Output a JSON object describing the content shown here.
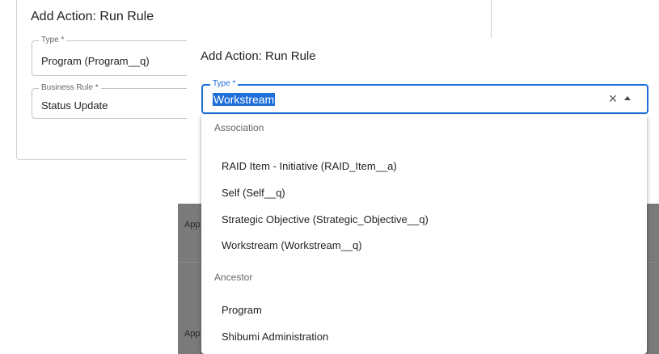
{
  "background_dialog": {
    "title": "Add Action: Run Rule",
    "type_field": {
      "label": "Type *",
      "value": "Program (Program__q)"
    },
    "business_rule_field": {
      "label": "Business Rule *",
      "value": "Status Update"
    }
  },
  "overlay": {
    "peek_texts": [
      "App",
      "App"
    ]
  },
  "front_dialog": {
    "title": "Add Action: Run Rule",
    "type_field": {
      "label": "Type *",
      "value": "Workstream"
    },
    "clear_icon": "close-icon",
    "toggle_icon": "arrow-up-icon",
    "accent_color": "#1e6fd9"
  },
  "dropdown": {
    "groups": [
      {
        "header": "Association",
        "options": [
          "RAID Item - Initiative (RAID_Item__a)",
          "Self (Self__q)",
          "Strategic Objective (Strategic_Objective__q)",
          "Workstream (Workstream__q)"
        ]
      },
      {
        "header": "Ancestor",
        "options": [
          "Program",
          "Shibumi Administration"
        ]
      }
    ]
  }
}
